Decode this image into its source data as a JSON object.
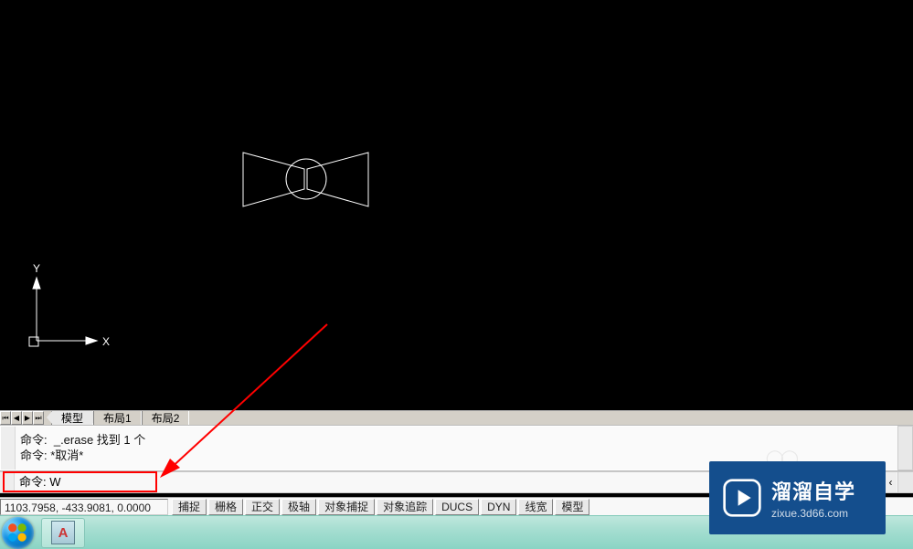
{
  "axis": {
    "x_label": "X",
    "y_label": "Y"
  },
  "tabs": [
    "模型",
    "布局1",
    "布局2"
  ],
  "active_tab": 0,
  "history_lines": [
    "命令:  _.erase 找到 1 个",
    "命令: *取消*"
  ],
  "command_line": "命令: W",
  "coords": "1103.7958, -433.9081, 0.0000",
  "status_buttons": [
    "捕捉",
    "栅格",
    "正交",
    "极轴",
    "对象捕捉",
    "对象追踪",
    "DUCS",
    "DYN",
    "线宽",
    "模型"
  ],
  "taskbar_app_icon_letter": "A",
  "brand": {
    "title": "溜溜自学",
    "subtitle": "zixue.3d66.com"
  }
}
